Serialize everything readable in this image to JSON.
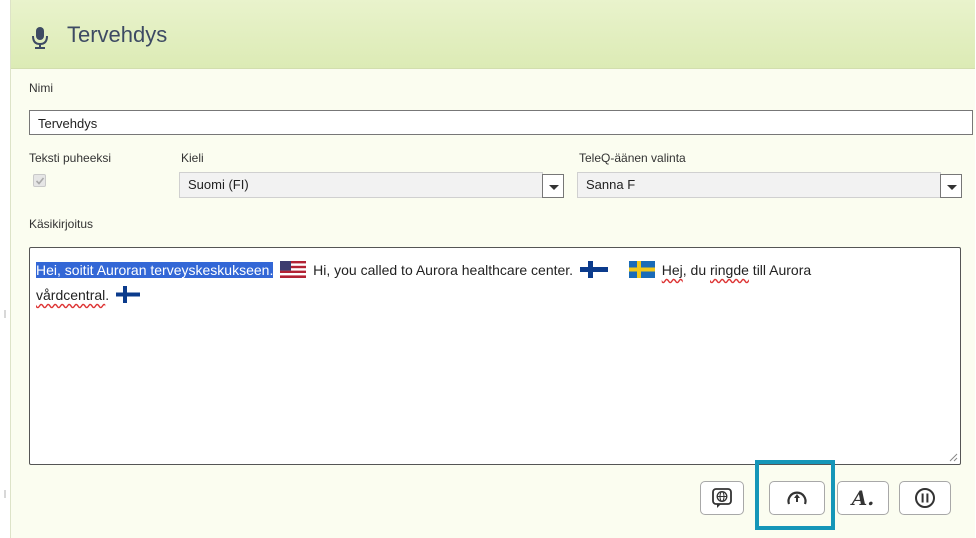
{
  "header": {
    "title": "Tervehdys",
    "icon": "microphone-icon"
  },
  "form": {
    "name_label": "Nimi",
    "name_value": "Tervehdys",
    "tts_label": "Teksti puheeksi",
    "tts_checked": true,
    "language_label": "Kieli",
    "language_value": "Suomi (FI)",
    "voice_label": "TeleQ-äänen valinta",
    "voice_value": "Sanna  F",
    "script_label": "Käsikirjoitus"
  },
  "script": {
    "segments": [
      {
        "text": "Hei, soitit Auroran terveyskeskukseen.",
        "selected": true
      },
      {
        "flag": "us-flag-icon"
      },
      {
        "text": "Hi, you called to Aurora healthcare center."
      },
      {
        "flag": "finland-flag-icon"
      },
      {
        "flag": "sweden-flag-icon"
      },
      {
        "text": "Hej",
        "spellcheck_error": true
      },
      {
        "text": ", du "
      },
      {
        "text": "ringde",
        "spellcheck_error": true
      },
      {
        "text": " till Aurora"
      },
      {
        "text": "vårdcentral",
        "spellcheck_error": true
      },
      {
        "text": "."
      },
      {
        "flag": "finland-flag-icon"
      }
    ]
  },
  "toolbar": {
    "language_button": "globe-speech-icon",
    "tempo_button": "speed-gauge-icon",
    "tempo_highlighted": true,
    "style_button_label": "A.",
    "pause_button": "pause-icon"
  },
  "colors": {
    "header_bg": "#dcebb5",
    "selection": "#3367d6",
    "highlight_border": "#1596b8",
    "panel_bg": "#fbfdf0"
  }
}
